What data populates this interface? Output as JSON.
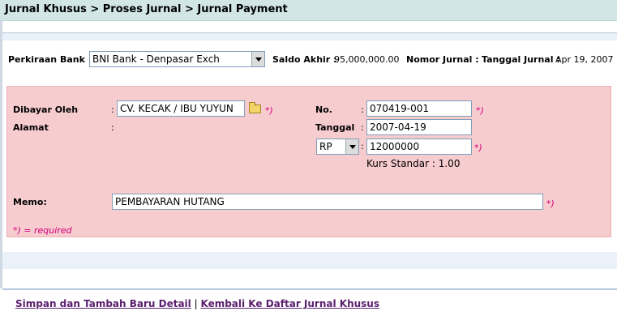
{
  "title": "Jurnal Khusus > Proses Jurnal > Jurnal Payment",
  "header": {
    "bank_label": "Perkiraan Bank :",
    "bank_selected": "BNI Bank - Denpasar Exch",
    "saldo_label": "Saldo Akhir :",
    "saldo_value": "95,000,000.00",
    "nomor_label": "Nomor Jurnal :",
    "tanggal_label": "Tanggal Jurnal :",
    "tanggal_value": "Apr 19, 2007"
  },
  "form": {
    "dibayar_label": "Dibayar Oleh",
    "colon": ":",
    "dibayar_value": "CV. KECAK / IBU YUYUN",
    "alamat_label": "Alamat",
    "no_label": "No.",
    "no_value": "070419-001",
    "tanggal_label": "Tanggal",
    "tanggal_value": "2007-04-19",
    "currency_selected": "RP",
    "amount_value": "12000000",
    "kurs_text": "Kurs Standar : 1.00",
    "memo_label": "Memo:",
    "memo_value": "PEMBAYARAN HUTANG",
    "required_mark": "*)",
    "required_note": "*) = required"
  },
  "links": {
    "save": "Simpan dan Tambah Baru Detail",
    "separator": "|",
    "back": "Kembali Ke Daftar Jurnal Khusus"
  },
  "colors": {
    "title_bar": "#d2e6e6",
    "form_background": "#f7cccf",
    "required": "#d0007a",
    "link": "#5a1f6e"
  },
  "icons": {
    "folder": "folder-icon",
    "dropdown": "chevron-down-icon"
  }
}
